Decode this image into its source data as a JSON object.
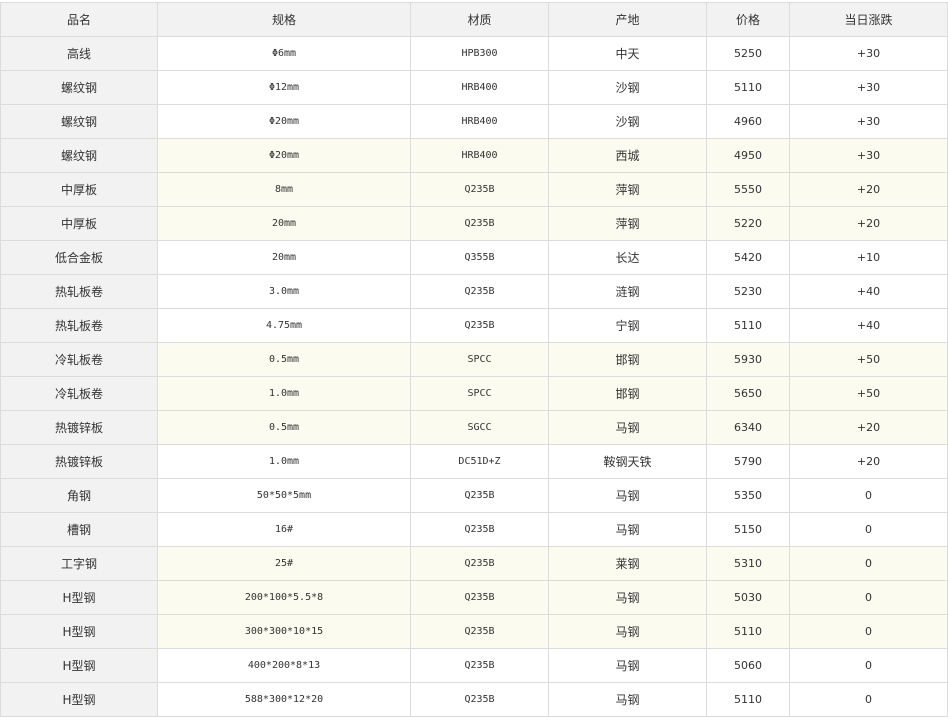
{
  "table": {
    "headers": [
      "品名",
      "规格",
      "材质",
      "产地",
      "价格",
      "当日涨跌"
    ],
    "rows": [
      {
        "name": "高线",
        "spec": "Φ6mm",
        "material": "HPB300",
        "origin": "中天",
        "price": "5250",
        "change": "+30",
        "highlight": false
      },
      {
        "name": "螺纹钢",
        "spec": "Φ12mm",
        "material": "HRB400",
        "origin": "沙钢",
        "price": "5110",
        "change": "+30",
        "highlight": false
      },
      {
        "name": "螺纹钢",
        "spec": "Φ20mm",
        "material": "HRB400",
        "origin": "沙钢",
        "price": "4960",
        "change": "+30",
        "highlight": false
      },
      {
        "name": "螺纹钢",
        "spec": "Φ20mm",
        "material": "HRB400",
        "origin": "西城",
        "price": "4950",
        "change": "+30",
        "highlight": true
      },
      {
        "name": "中厚板",
        "spec": "8mm",
        "material": "Q235B",
        "origin": "萍钢",
        "price": "5550",
        "change": "+20",
        "highlight": true
      },
      {
        "name": "中厚板",
        "spec": "20mm",
        "material": "Q235B",
        "origin": "萍钢",
        "price": "5220",
        "change": "+20",
        "highlight": true
      },
      {
        "name": "低合金板",
        "spec": "20mm",
        "material": "Q355B",
        "origin": "长达",
        "price": "5420",
        "change": "+10",
        "highlight": false
      },
      {
        "name": "热轧板卷",
        "spec": "3.0mm",
        "material": "Q235B",
        "origin": "涟钢",
        "price": "5230",
        "change": "+40",
        "highlight": false
      },
      {
        "name": "热轧板卷",
        "spec": "4.75mm",
        "material": "Q235B",
        "origin": "宁钢",
        "price": "5110",
        "change": "+40",
        "highlight": false
      },
      {
        "name": "冷轧板卷",
        "spec": "0.5mm",
        "material": "SPCC",
        "origin": "邯钢",
        "price": "5930",
        "change": "+50",
        "highlight": true
      },
      {
        "name": "冷轧板卷",
        "spec": "1.0mm",
        "material": "SPCC",
        "origin": "邯钢",
        "price": "5650",
        "change": "+50",
        "highlight": true
      },
      {
        "name": "热镀锌板",
        "spec": "0.5mm",
        "material": "SGCC",
        "origin": "马钢",
        "price": "6340",
        "change": "+20",
        "highlight": true
      },
      {
        "name": "热镀锌板",
        "spec": "1.0mm",
        "material": "DC51D+Z",
        "origin": "鞍钢天铁",
        "price": "5790",
        "change": "+20",
        "highlight": false
      },
      {
        "name": "角钢",
        "spec": "50*50*5mm",
        "material": "Q235B",
        "origin": "马钢",
        "price": "5350",
        "change": "0",
        "highlight": false
      },
      {
        "name": "槽钢",
        "spec": "16#",
        "material": "Q235B",
        "origin": "马钢",
        "price": "5150",
        "change": "0",
        "highlight": false
      },
      {
        "name": "工字钢",
        "spec": "25#",
        "material": "Q235B",
        "origin": "莱钢",
        "price": "5310",
        "change": "0",
        "highlight": true
      },
      {
        "name": "H型钢",
        "spec": "200*100*5.5*8",
        "material": "Q235B",
        "origin": "马钢",
        "price": "5030",
        "change": "0",
        "highlight": true
      },
      {
        "name": "H型钢",
        "spec": "300*300*10*15",
        "material": "Q235B",
        "origin": "马钢",
        "price": "5110",
        "change": "0",
        "highlight": true
      },
      {
        "name": "H型钢",
        "spec": "400*200*8*13",
        "material": "Q235B",
        "origin": "马钢",
        "price": "5060",
        "change": "0",
        "highlight": false
      },
      {
        "name": "H型钢",
        "spec": "588*300*12*20",
        "material": "Q235B",
        "origin": "马钢",
        "price": "5110",
        "change": "0",
        "highlight": false
      }
    ]
  },
  "colors": {
    "header_bg": "#f2f2f2",
    "highlight_bg": "#fcfbef",
    "border": "#dcdcdc",
    "text": "#333333"
  }
}
